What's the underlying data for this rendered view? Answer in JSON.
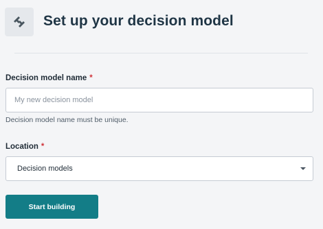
{
  "header": {
    "icon": "decision-model-icon",
    "title": "Set up your decision model"
  },
  "form": {
    "name_field": {
      "label": "Decision model name",
      "required_marker": "*",
      "value": "",
      "placeholder": "My new decision model",
      "help_text": "Decision model name must be unique."
    },
    "location_field": {
      "label": "Location",
      "required_marker": "*",
      "selected_value": "Decision models",
      "icon": "chevron-down-icon"
    },
    "submit_label": "Start building"
  },
  "colors": {
    "primary_button": "#137d87",
    "required_marker": "#d0343a",
    "title_text": "#1f3545",
    "icon_tile": "#e5e8ec",
    "icon_glyph": "#49565f",
    "background": "#f4f5f7"
  }
}
